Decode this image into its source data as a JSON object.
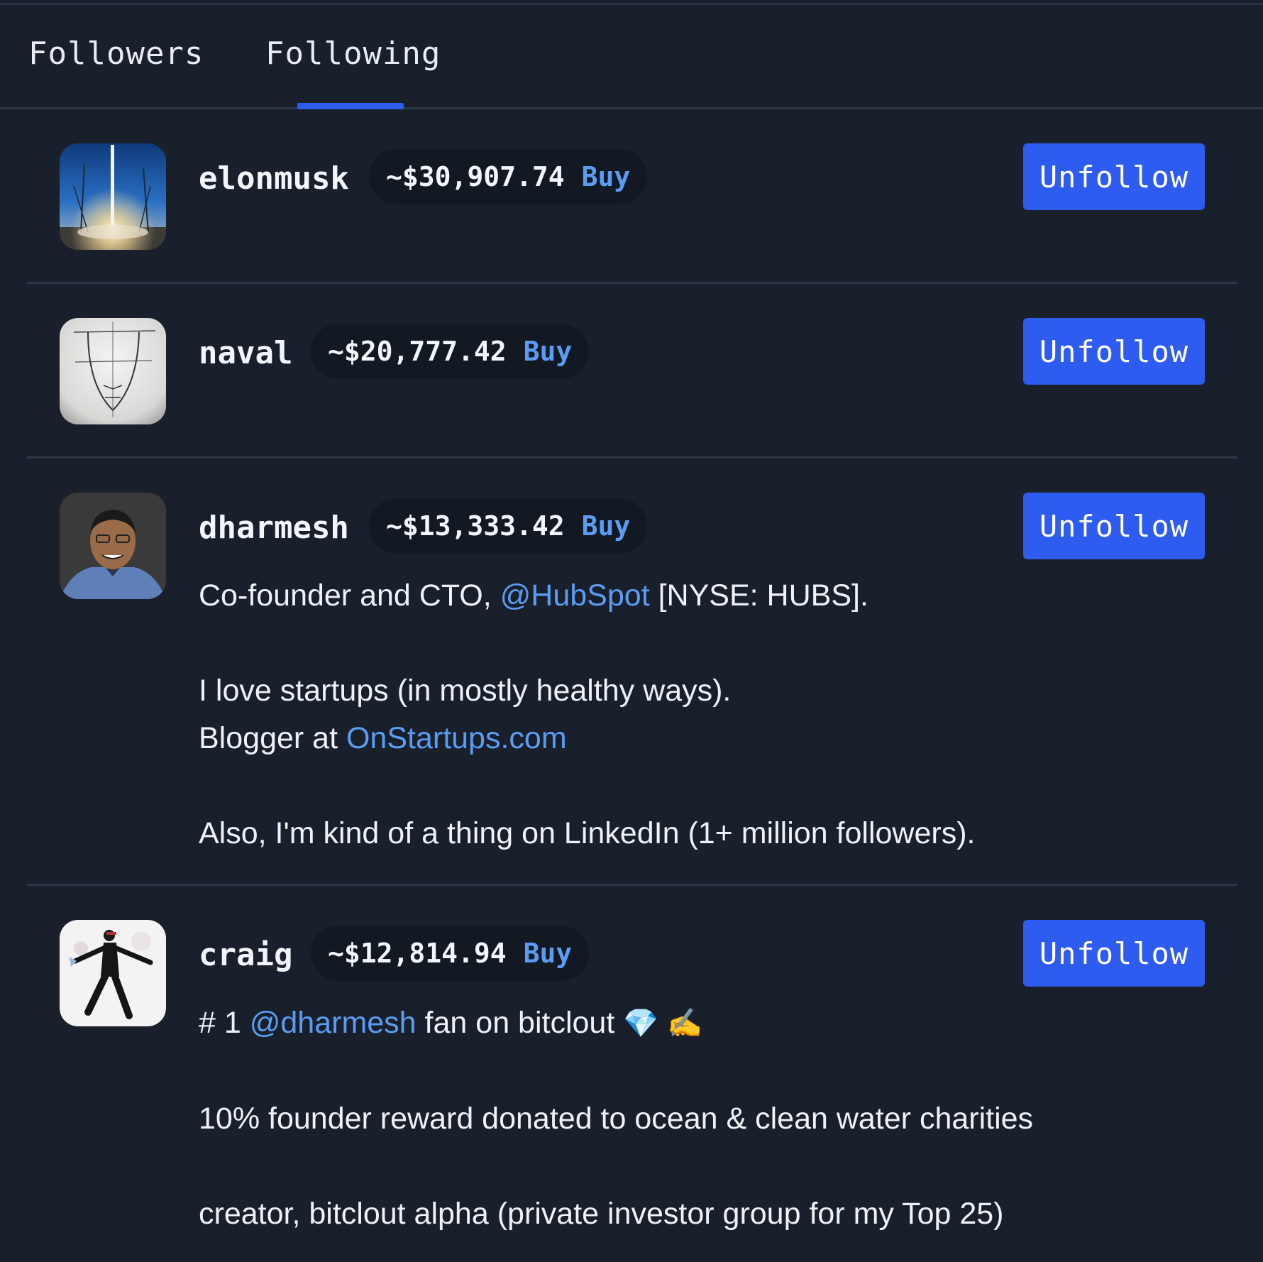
{
  "tabs": {
    "followers": "Followers",
    "following": "Following"
  },
  "users": [
    {
      "username": "elonmusk",
      "price": "~$30,907.74",
      "buy": "Buy",
      "action": "Unfollow"
    },
    {
      "username": "naval",
      "price": "~$20,777.42",
      "buy": "Buy",
      "action": "Unfollow"
    },
    {
      "username": "dharmesh",
      "price": "~$13,333.42",
      "buy": "Buy",
      "action": "Unfollow",
      "bio": {
        "line1_prefix": "Co-founder and CTO, ",
        "line1_link": "@HubSpot",
        "line1_suffix": " [NYSE: HUBS].",
        "line2": "I love startups (in mostly healthy ways).",
        "line3_prefix": "Blogger at ",
        "line3_link": "OnStartups.com",
        "line4": "Also, I'm kind of a thing on LinkedIn (1+ million followers)."
      }
    },
    {
      "username": "craig",
      "price": "~$12,814.94",
      "buy": "Buy",
      "action": "Unfollow",
      "bio": {
        "line1_prefix": "# 1 ",
        "line1_link": "@dharmesh",
        "line1_suffix": " fan on bitclout",
        "emoji1": "💎",
        "emoji2": "✍️",
        "line2": "10% founder reward donated to ocean & clean water charities",
        "line3": "creator, bitclout alpha (private investor group for my Top 25)"
      }
    }
  ],
  "colors": {
    "background": "#19202b",
    "accent": "#2e5bf0",
    "link": "#5b9cf2",
    "pill": "#131922",
    "divider": "#2e3745"
  }
}
